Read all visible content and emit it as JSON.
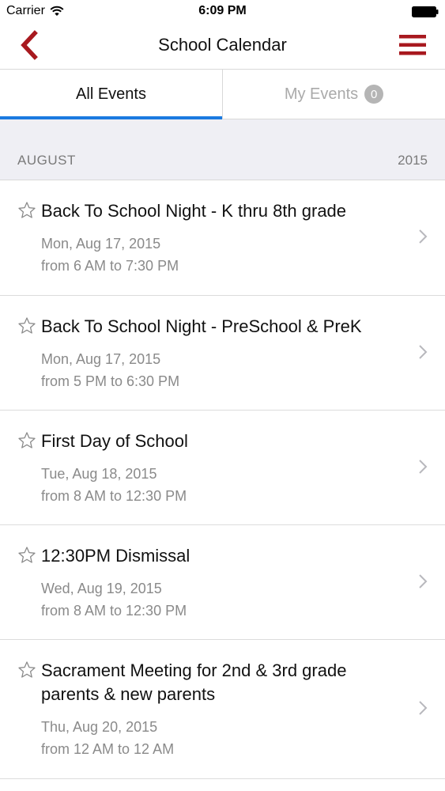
{
  "status_bar": {
    "carrier": "Carrier",
    "time": "6:09 PM"
  },
  "nav": {
    "title": "School Calendar",
    "accent_color": "#a8191f"
  },
  "tabs": {
    "all_label": "All Events",
    "my_label": "My Events",
    "my_count": "0",
    "active_color": "#1a7ae0"
  },
  "section": {
    "month": "AUGUST",
    "year": "2015"
  },
  "events": [
    {
      "title": "Back To School Night - K thru 8th grade",
      "date": "Mon, Aug 17, 2015",
      "time": "from 6 AM to 7:30 PM",
      "starred": false
    },
    {
      "title": "Back To School Night - PreSchool & PreK",
      "date": "Mon, Aug 17, 2015",
      "time": "from 5 PM to 6:30 PM",
      "starred": false
    },
    {
      "title": "First Day of School",
      "date": "Tue, Aug 18, 2015",
      "time": "from 8 AM to 12:30 PM",
      "starred": false
    },
    {
      "title": "12:30PM Dismissal",
      "date": "Wed, Aug 19, 2015",
      "time": "from 8 AM to 12:30 PM",
      "starred": false
    },
    {
      "title": "Sacrament Meeting for 2nd & 3rd grade parents & new parents",
      "date": "Thu, Aug 20, 2015",
      "time": "from 12 AM to 12 AM",
      "starred": false
    }
  ]
}
